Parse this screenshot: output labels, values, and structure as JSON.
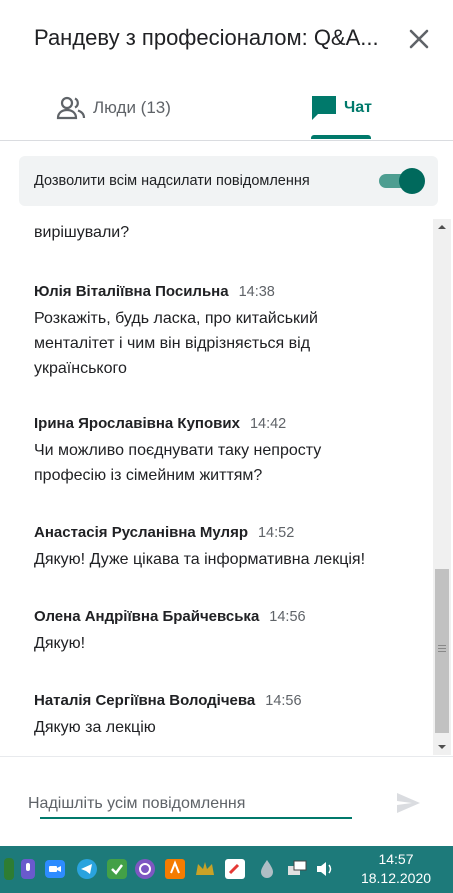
{
  "header": {
    "title": "Рандеву з професіоналом: Q&A...",
    "close_icon": "close-icon"
  },
  "tabs": {
    "people": {
      "label": "Люди (13)",
      "icon": "people-icon"
    },
    "chat": {
      "label": "Чат",
      "icon": "chat-icon",
      "active": true
    }
  },
  "settings": {
    "allow_messages_label": "Дозволити всім надсилати повідомлення",
    "allow_messages_on": true
  },
  "chat": {
    "continuation": "вирішували?",
    "messages": [
      {
        "sender": "Юлія Віталіївна Посильна",
        "time": "14:38",
        "lines": [
          "Розкажіть, будь ласка, про китайський",
          "менталітет і чим він відрізняється від",
          "українського"
        ]
      },
      {
        "sender": "Ірина Ярославівна Купових",
        "time": "14:42",
        "lines": [
          "Чи можливо поєднувати таку непросту",
          "професію із сімейним життям?"
        ]
      },
      {
        "sender": "Анастасія Русланівна Муляр",
        "time": "14:52",
        "lines": [
          "Дякую! Дуже цікава та інформативна лекція!"
        ]
      },
      {
        "sender": "Олена Андріївна Брайчевська",
        "time": "14:56",
        "lines": [
          "Дякую!"
        ]
      },
      {
        "sender": "Наталія Сергіївна Володічева",
        "time": "14:56",
        "lines": [
          "Дякую за лекцію"
        ]
      }
    ]
  },
  "composer": {
    "placeholder": "Надішліть усім повідомлення",
    "value": "",
    "send_icon": "send-icon"
  },
  "taskbar": {
    "time": "14:57",
    "date": "18.12.2020",
    "icons": [
      "mic-icon",
      "video-icon",
      "telegram-icon",
      "check-icon",
      "viber-icon",
      "app-icon",
      "crown-icon",
      "edit-icon",
      "droplet-icon",
      "network-icon",
      "volume-icon"
    ]
  },
  "colors": {
    "accent": "#00796b",
    "taskbar": "#1d7a7a"
  }
}
